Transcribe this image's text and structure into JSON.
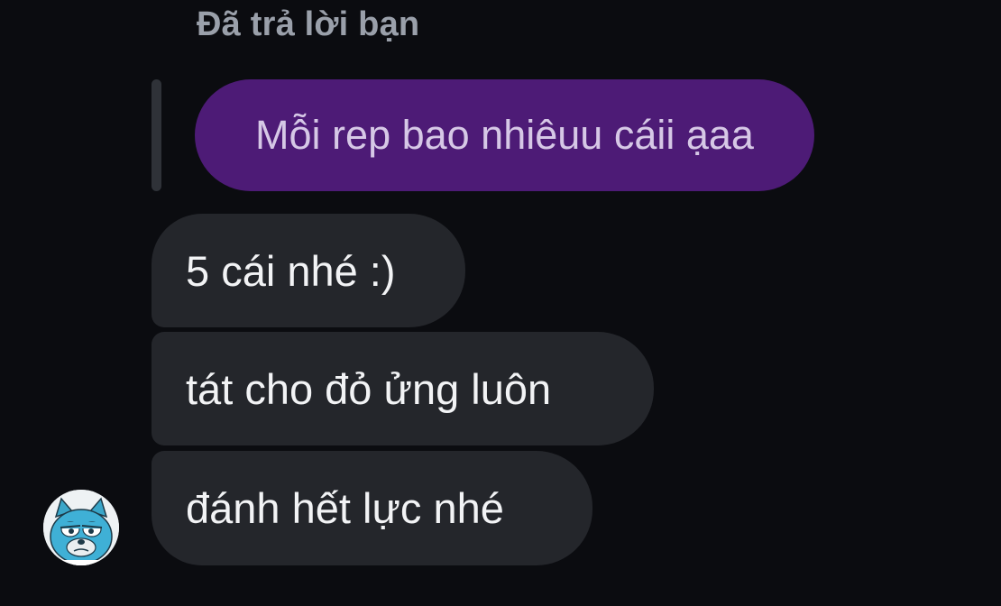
{
  "reply_header": "Đã trả lời bạn",
  "quoted_message": "Mỗi rep bao nhiêuu cáii ạaa",
  "messages": [
    "5 cái nhé :)",
    "tát cho đỏ ửng luôn",
    "đánh hết lực nhé"
  ],
  "colors": {
    "background": "#0b0c10",
    "quoted_bubble": "#4d1b76",
    "incoming_bubble": "#24262b",
    "header_text": "#9aa0aa"
  },
  "avatar_icon": "cartoon-cat-avatar-icon"
}
